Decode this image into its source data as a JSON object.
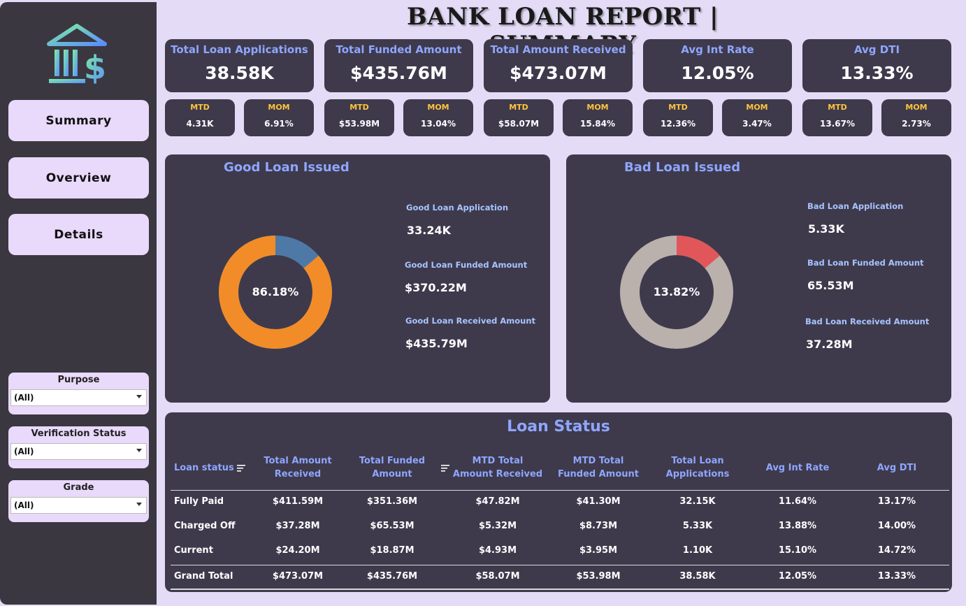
{
  "title": "BANK LOAN REPORT | SUMMARY",
  "nav": {
    "summary": "Summary",
    "overview": "Overview",
    "details": "Details"
  },
  "slicers": [
    {
      "label": "Purpose",
      "value": "(All)"
    },
    {
      "label": "Verification Status",
      "value": "(All)"
    },
    {
      "label": "Grade",
      "value": "(All)"
    }
  ],
  "kpis": [
    {
      "label": "Total Loan Applications",
      "value": "38.58K",
      "mtd_label": "MTD",
      "mtd": "4.31K",
      "mom_label": "MOM",
      "mom": "6.91%"
    },
    {
      "label": "Total Funded Amount",
      "value": "$435.76M",
      "mtd_label": "MTD",
      "mtd": "$53.98M",
      "mom_label": "MOM",
      "mom": "13.04%"
    },
    {
      "label": "Total Amount Received",
      "value": "$473.07M",
      "mtd_label": "MTD",
      "mtd": "$58.07M",
      "mom_label": "MOM",
      "mom": "15.84%"
    },
    {
      "label": "Avg Int Rate",
      "value": "12.05%",
      "mtd_label": "MTD",
      "mtd": "12.36%",
      "mom_label": "MOM",
      "mom": "3.47%"
    },
    {
      "label": "Avg DTI",
      "value": "13.33%",
      "mtd_label": "MTD",
      "mtd": "13.67%",
      "mom_label": "MOM",
      "mom": "2.73%"
    }
  ],
  "good_loan": {
    "title": "Good Loan Issued",
    "center": "86.18%",
    "share": 0.8618,
    "main_color": "#f28c28",
    "rest_color": "#4e79a7",
    "app_label": "Good Loan Application",
    "app_value": "33.24K",
    "funded_label": "Good Loan Funded Amount",
    "funded_value": "$370.22M",
    "received_label": "Good Loan Received Amount",
    "received_value": "$435.79M"
  },
  "bad_loan": {
    "title": "Bad Loan Issued",
    "center": "13.82%",
    "share": 0.1382,
    "main_color": "#e15759",
    "rest_color": "#bab0ac",
    "app_label": "Bad Loan Application",
    "app_value": "5.33K",
    "funded_label": "Bad Loan Funded Amount",
    "funded_value": "65.53M",
    "received_label": "Bad Loan Received Amount",
    "received_value": "37.28M"
  },
  "loan_status": {
    "title": "Loan Status",
    "headers": [
      "Loan status",
      "Total Amount Received",
      "Total Funded Amount",
      "MTD Total Amount Received",
      "MTD Total Funded Amount",
      "Total Loan Applications",
      "Avg Int Rate",
      "Avg DTI"
    ],
    "rows": [
      [
        "Fully Paid",
        "$411.59M",
        "$351.36M",
        "$47.82M",
        "$41.30M",
        "32.15K",
        "11.64%",
        "13.17%"
      ],
      [
        "Charged Off",
        "$37.28M",
        "$65.53M",
        "$5.32M",
        "$8.73M",
        "5.33K",
        "13.88%",
        "14.00%"
      ],
      [
        "Current",
        "$24.20M",
        "$18.87M",
        "$4.93M",
        "$3.95M",
        "1.10K",
        "15.10%",
        "14.72%"
      ]
    ],
    "total": [
      "Grand Total",
      "$473.07M",
      "$435.76M",
      "$58.07M",
      "$53.98M",
      "38.58K",
      "12.05%",
      "13.33%"
    ]
  }
}
